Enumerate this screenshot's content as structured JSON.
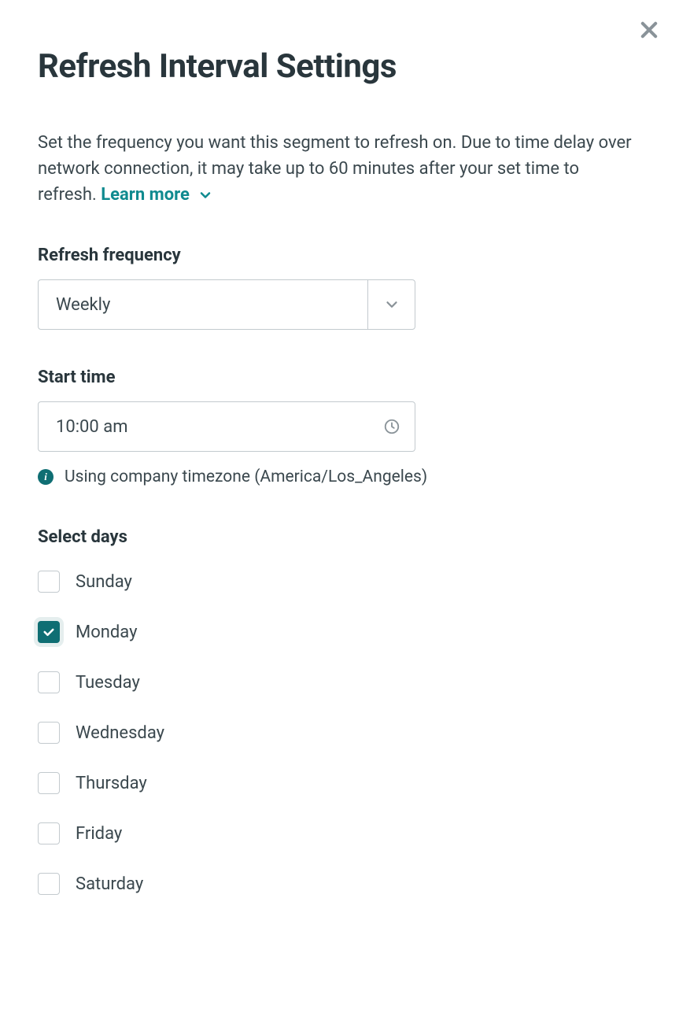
{
  "header": {
    "title": "Refresh Interval Settings"
  },
  "description": {
    "text": "Set the frequency you want this segment to refresh on. Due to time delay over network connection, it may take up to 60 minutes after your set time to refresh. ",
    "learn_more_label": "Learn more"
  },
  "frequency": {
    "label": "Refresh frequency",
    "value": "Weekly"
  },
  "start_time": {
    "label": "Start time",
    "value": "10:00 am",
    "timezone_note": "Using company timezone (America/Los_Angeles)"
  },
  "days": {
    "label": "Select days",
    "items": [
      {
        "label": "Sunday",
        "checked": false
      },
      {
        "label": "Monday",
        "checked": true
      },
      {
        "label": "Tuesday",
        "checked": false
      },
      {
        "label": "Wednesday",
        "checked": false
      },
      {
        "label": "Thursday",
        "checked": false
      },
      {
        "label": "Friday",
        "checked": false
      },
      {
        "label": "Saturday",
        "checked": false
      }
    ]
  }
}
